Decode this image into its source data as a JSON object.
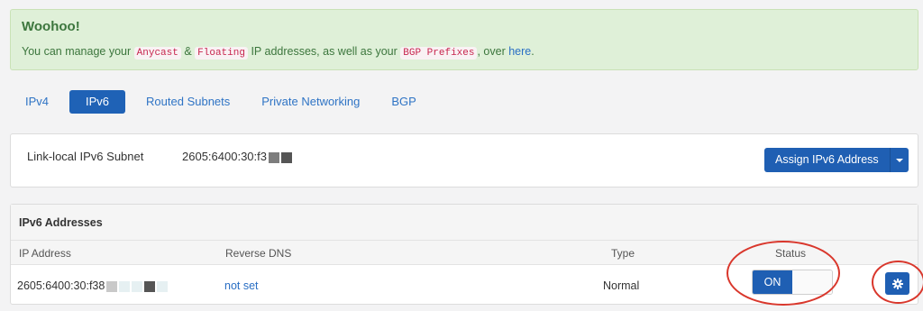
{
  "alert": {
    "title": "Woohoo!",
    "text_1": "You can manage your ",
    "code_anycast": "Anycast",
    "text_2": " & ",
    "code_floating": "Floating",
    "text_3": " IP addresses, as well as your ",
    "code_bgp": "BGP Prefixes",
    "text_4": ", over ",
    "link": "here",
    "text_5": "."
  },
  "tabs": [
    {
      "label": "IPv4"
    },
    {
      "label": "IPv6",
      "active": true
    },
    {
      "label": "Routed Subnets"
    },
    {
      "label": "Private Networking"
    },
    {
      "label": "BGP"
    }
  ],
  "subnet": {
    "label": "Link-local IPv6 Subnet",
    "value": "2605:6400:30:f3",
    "assign_label": "Assign IPv6 Address"
  },
  "addresses": {
    "heading": "IPv6 Addresses",
    "columns": {
      "ip": "IP Address",
      "rdns": "Reverse DNS",
      "type": "Type",
      "status": "Status"
    },
    "rows": [
      {
        "ip": "2605:6400:30:f38",
        "rdns": "not set",
        "type": "Normal",
        "status": "ON"
      }
    ]
  },
  "colors": {
    "primary": "#1f5fb3",
    "alert_bg": "#dff0d8",
    "alert_text": "#3c763d",
    "highlight": "#d9372c"
  },
  "icons": {
    "settings": "gear-icon",
    "dropdown": "caret-down-icon"
  }
}
